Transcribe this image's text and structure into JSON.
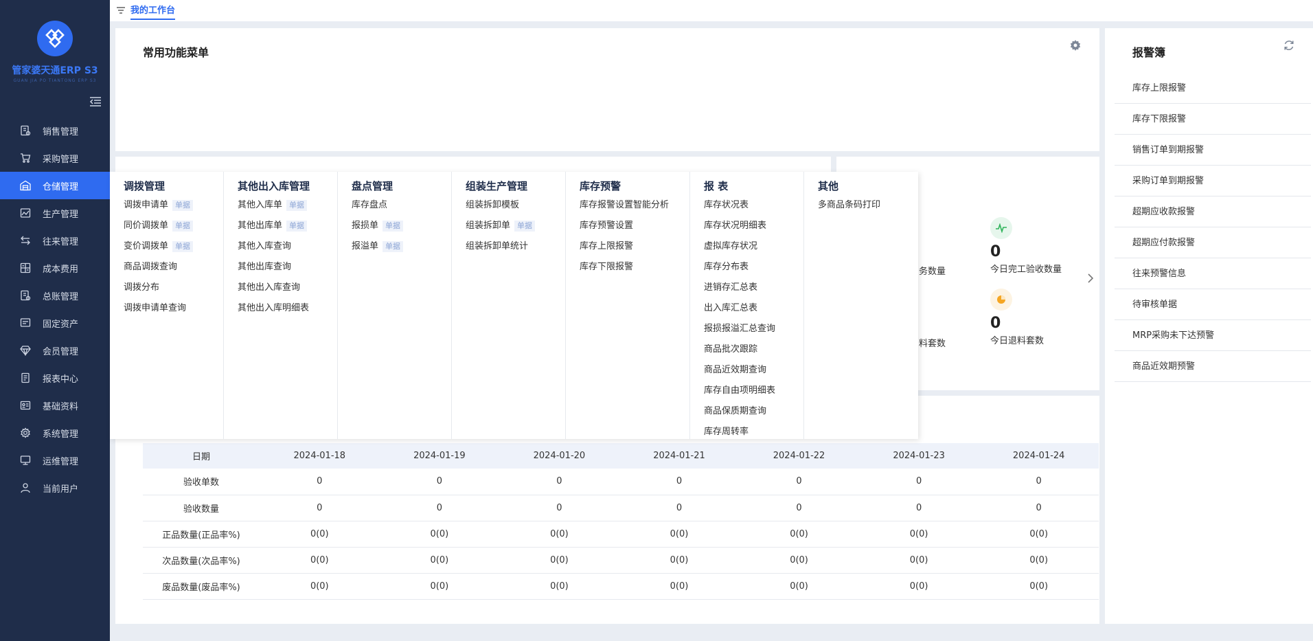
{
  "brand": {
    "title": "管家婆天通ERP S3",
    "subtitle": "GUAN JIA PO TIANTONG ERP S3"
  },
  "sidebar": {
    "items": [
      {
        "label": "销售管理",
        "icon": "receipt-icon"
      },
      {
        "label": "采购管理",
        "icon": "cart-icon"
      },
      {
        "label": "仓储管理",
        "icon": "warehouse-icon"
      },
      {
        "label": "生产管理",
        "icon": "production-icon"
      },
      {
        "label": "往来管理",
        "icon": "exchange-icon"
      },
      {
        "label": "成本费用",
        "icon": "calculator-icon"
      },
      {
        "label": "总账管理",
        "icon": "ledger-icon"
      },
      {
        "label": "固定资产",
        "icon": "asset-icon"
      },
      {
        "label": "会员管理",
        "icon": "diamond-icon"
      },
      {
        "label": "报表中心",
        "icon": "report-icon"
      },
      {
        "label": "基础资料",
        "icon": "id-card-icon"
      },
      {
        "label": "系统管理",
        "icon": "gear-icon"
      },
      {
        "label": "运维管理",
        "icon": "monitor-icon"
      },
      {
        "label": "当前用户",
        "icon": "user-icon"
      }
    ]
  },
  "topbar": {
    "active_tab": "我的工作台"
  },
  "common_menu": {
    "title": "常用功能菜单"
  },
  "alarm": {
    "title": "报警簿",
    "items": [
      "库存上限报警",
      "库存下限报警",
      "销售订单到期报警",
      "采购订单到期报警",
      "超期应收款报警",
      "超期应付款报警",
      "往来预警信息",
      "待审核单据",
      "MRP采购未下达预警",
      "商品近效期预警"
    ]
  },
  "stats": {
    "s1": {
      "value": "0",
      "label": "今日完工验收数量"
    },
    "s2": {
      "value": "0",
      "label": "今日退料套数"
    },
    "partial1": "务数量",
    "partial2": "料套数",
    "colors": {
      "green": "#2fb35a",
      "orange": "#f5a623"
    }
  },
  "table": {
    "headers": [
      "日期",
      "2024-01-18",
      "2024-01-19",
      "2024-01-20",
      "2024-01-21",
      "2024-01-22",
      "2024-01-23",
      "2024-01-24"
    ],
    "rows": [
      [
        "验收单数",
        "0",
        "0",
        "0",
        "0",
        "0",
        "0",
        "0"
      ],
      [
        "验收数量",
        "0",
        "0",
        "0",
        "0",
        "0",
        "0",
        "0"
      ],
      [
        "正品数量(正品率%)",
        "0(0)",
        "0(0)",
        "0(0)",
        "0(0)",
        "0(0)",
        "0(0)",
        "0(0)"
      ],
      [
        "次品数量(次品率%)",
        "0(0)",
        "0(0)",
        "0(0)",
        "0(0)",
        "0(0)",
        "0(0)",
        "0(0)"
      ],
      [
        "废品数量(废品率%)",
        "0(0)",
        "0(0)",
        "0(0)",
        "0(0)",
        "0(0)",
        "0(0)",
        "0(0)"
      ]
    ]
  },
  "mega_menu": {
    "tag_label": "单据",
    "columns": [
      {
        "title": "调拨管理",
        "items": [
          {
            "label": "调拨申请单",
            "tag": true
          },
          {
            "label": "同价调拨单",
            "tag": true
          },
          {
            "label": "变价调拨单",
            "tag": true
          },
          {
            "label": "商品调拨查询"
          },
          {
            "label": "调拨分布"
          },
          {
            "label": "调拨申请单查询"
          }
        ]
      },
      {
        "title": "其他出入库管理",
        "items": [
          {
            "label": "其他入库单",
            "tag": true
          },
          {
            "label": "其他出库单",
            "tag": true
          },
          {
            "label": "其他入库查询"
          },
          {
            "label": "其他出库查询"
          },
          {
            "label": "其他出入库查询"
          },
          {
            "label": "其他出入库明细表"
          }
        ]
      },
      {
        "title": "盘点管理",
        "items": [
          {
            "label": "库存盘点"
          },
          {
            "label": "报损单",
            "tag": true
          },
          {
            "label": "报溢单",
            "tag": true
          }
        ]
      },
      {
        "title": "组装生产管理",
        "items": [
          {
            "label": "组装拆卸模板"
          },
          {
            "label": "组装拆卸单",
            "tag": true
          },
          {
            "label": "组装拆卸单统计"
          }
        ]
      },
      {
        "title": "库存预警",
        "items": [
          {
            "label": "库存报警设置智能分析"
          },
          {
            "label": "库存预警设置"
          },
          {
            "label": "库存上限报警"
          },
          {
            "label": "库存下限报警"
          }
        ]
      },
      {
        "title": "报 表",
        "items": [
          {
            "label": "库存状况表"
          },
          {
            "label": "库存状况明细表"
          },
          {
            "label": "虚拟库存状况"
          },
          {
            "label": "库存分布表"
          },
          {
            "label": "进销存汇总表"
          },
          {
            "label": "出入库汇总表"
          },
          {
            "label": "报损报溢汇总查询"
          },
          {
            "label": "商品批次跟踪"
          },
          {
            "label": "商品近效期查询"
          },
          {
            "label": "库存自由项明细表"
          },
          {
            "label": "商品保质期查询"
          },
          {
            "label": "库存周转率"
          }
        ]
      },
      {
        "title": "其他",
        "items": [
          {
            "label": "多商品条码打印"
          }
        ]
      }
    ]
  }
}
